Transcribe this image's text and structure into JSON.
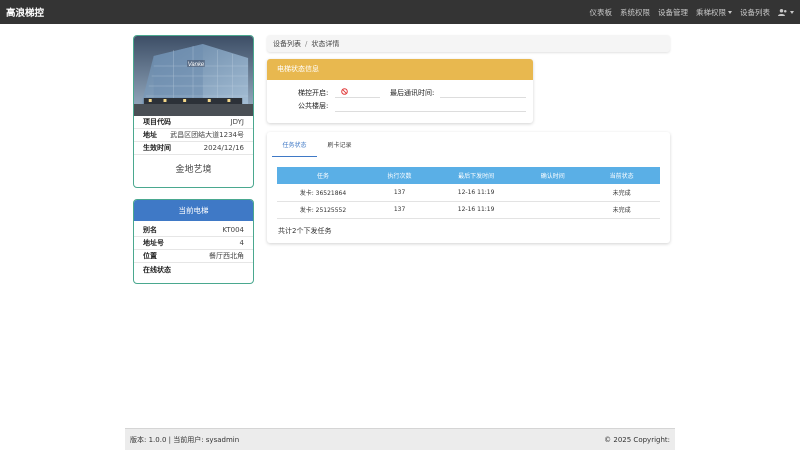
{
  "app": {
    "title": "高浪梯控"
  },
  "nav": {
    "items": [
      {
        "label": "仪表板"
      },
      {
        "label": "系统权限"
      },
      {
        "label": "设备管理"
      },
      {
        "label": "乘梯权限"
      },
      {
        "label": "设备列表"
      }
    ]
  },
  "project": {
    "rows": [
      {
        "key": "项目代码",
        "value": "JDYJ"
      },
      {
        "key": "地址",
        "value": "武昌区团结大道1234号"
      },
      {
        "key": "生效时间",
        "value": "2024/12/16"
      }
    ],
    "name": "金地艺境",
    "image_sign": "Vanke"
  },
  "elevator": {
    "header": "当前电梯",
    "rows": [
      {
        "key": "别名",
        "value": "KT004"
      },
      {
        "key": "地址号",
        "value": "4"
      },
      {
        "key": "位置",
        "value": "餐厅西北角"
      },
      {
        "key": "在线状态",
        "value": ""
      }
    ]
  },
  "breadcrumb": {
    "parent": "设备列表",
    "sep": "/",
    "current": "状态详情"
  },
  "status": {
    "header": "电梯状态信息",
    "lift_control_label": "梯控开启:",
    "last_comm_label": "最后通讯时间:",
    "last_comm_value": "",
    "public_floor_label": "公共楼层:",
    "public_floor_value": ""
  },
  "tabs": [
    {
      "label": "任务状态"
    },
    {
      "label": "刷卡记录"
    }
  ],
  "table": {
    "headers": [
      "任务",
      "执行次数",
      "最后下发时间",
      "确认时间",
      "当前状态"
    ],
    "rows": [
      [
        "发卡: 36521864",
        "137",
        "12-16 11:19",
        "",
        "未完成"
      ],
      [
        "发卡: 25125552",
        "137",
        "12-16 11:19",
        "",
        "未完成"
      ]
    ],
    "total": "共计2个下发任务"
  },
  "footer": {
    "version": "版本: 1.0.0 | 当前用户: sysadmin",
    "copyright": "© 2025 Copyright:"
  },
  "colors": {
    "navbar": "#343434",
    "project_border": "#4aa88f",
    "elevator_header": "#3f79c6",
    "status_header": "#e8b84f",
    "table_header": "#5aafe6",
    "ban_icon": "#e03b3b"
  }
}
